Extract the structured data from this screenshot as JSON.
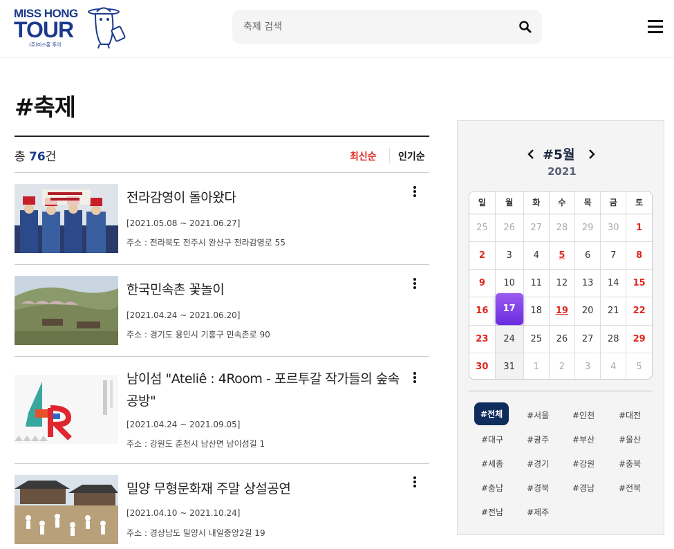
{
  "header": {
    "logo_line1": "MISS HONG",
    "logo_line2": "TOUR",
    "logo_sub": "(주)미스홍 투어",
    "search_placeholder": "축제 검색",
    "search_icon": "search-icon",
    "menu_icon": "hamburger-menu-icon"
  },
  "page": {
    "title": "#축제",
    "count_prefix": "총 ",
    "count_value": "76",
    "count_suffix": "건",
    "sort_latest": "최신순",
    "sort_popular": "인기순"
  },
  "items": [
    {
      "title": "전라감영이 돌아왔다",
      "date": "[2021.05.08 ~ 2021.06.27]",
      "address": "주소 : 전라북도 전주시 완산구 전라감영로 55"
    },
    {
      "title": "한국민속촌 꽃놀이",
      "date": "[2021.04.24 ~ 2021.06.20]",
      "address": "주소 : 경기도 용인시 기흥구 민속촌로 90"
    },
    {
      "title": "남이섬 \"Ateliê : 4Room - 포르투갈 작가들의 숲속 공방\"",
      "date": "[2021.04.24 ~ 2021.09.05]",
      "address": "주소 : 강원도 춘천시 남산면 남이섬길 1"
    },
    {
      "title": "밀양 무형문화재 주말 상설공연",
      "date": "[2021.04.10 ~ 2021.10.24]",
      "address": "주소 : 경상남도 밀양시 내일중앙2길 19"
    }
  ],
  "calendar": {
    "month": "#5월",
    "year": "2021",
    "weekdays": [
      "일",
      "월",
      "화",
      "수",
      "목",
      "금",
      "토"
    ],
    "weeks": [
      [
        "25",
        "26",
        "27",
        "28",
        "29",
        "30",
        "1"
      ],
      [
        "2",
        "3",
        "4",
        "5",
        "6",
        "7",
        "8"
      ],
      [
        "9",
        "10",
        "11",
        "12",
        "13",
        "14",
        "15"
      ],
      [
        "16",
        "17",
        "18",
        "19",
        "20",
        "21",
        "22"
      ],
      [
        "23",
        "24",
        "25",
        "26",
        "27",
        "28",
        "29"
      ],
      [
        "30",
        "31",
        "1",
        "2",
        "3",
        "4",
        "5"
      ]
    ],
    "selected_day": "17",
    "accent_color": "#7b3fe8"
  },
  "regions": [
    "#전체",
    "#서울",
    "#인천",
    "#대전",
    "#대구",
    "#광주",
    "#부산",
    "#울산",
    "#세종",
    "#경기",
    "#강원",
    "#충북",
    "#충남",
    "#경북",
    "#경남",
    "#전북",
    "#전남",
    "#제주"
  ],
  "colors": {
    "brand": "#1a3a8c",
    "accent_red": "#e0261e",
    "active_tag": "#0f2d5c"
  }
}
